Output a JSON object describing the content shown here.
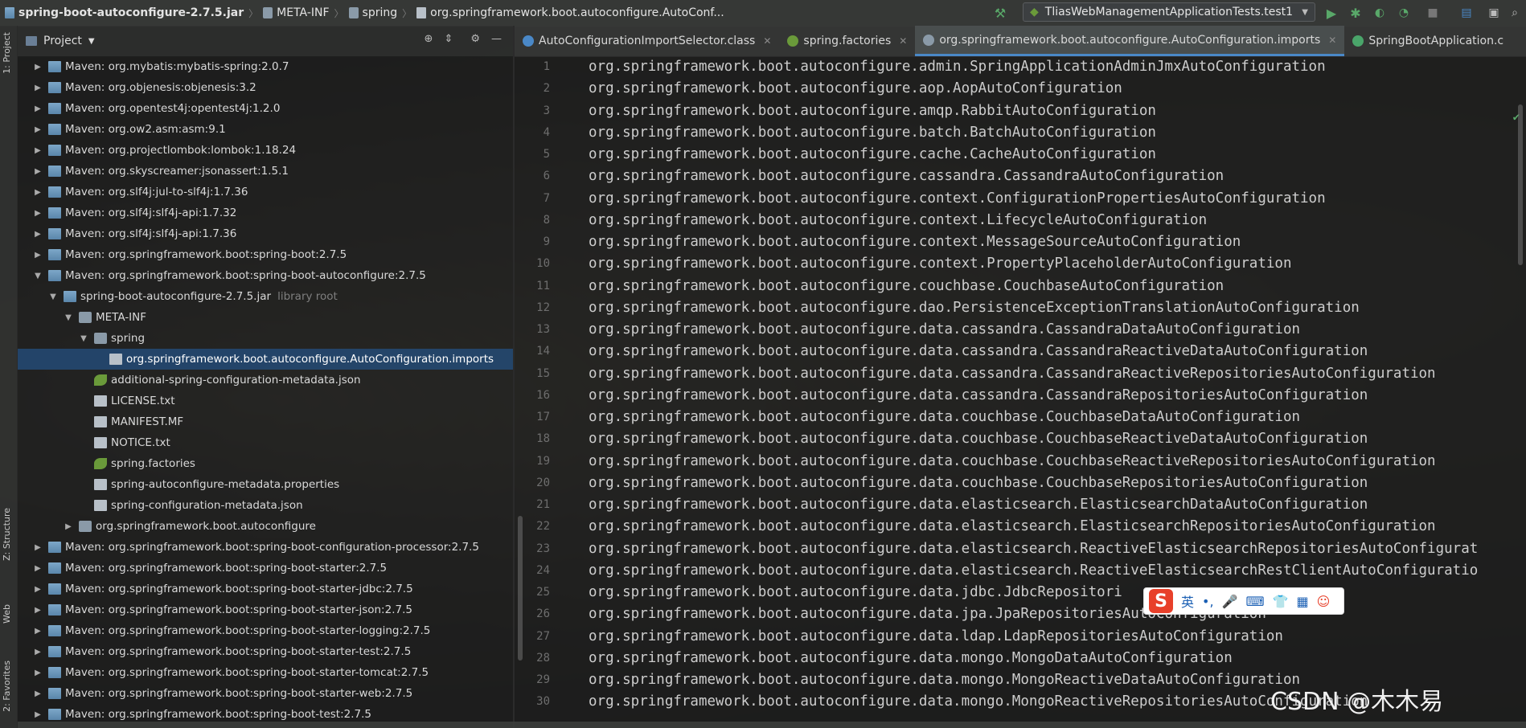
{
  "breadcrumbs": [
    {
      "label": "spring-boot-autoconfigure-2.7.5.jar",
      "bold": true
    },
    {
      "label": "META-INF"
    },
    {
      "label": "spring"
    },
    {
      "label": "org.springframework.boot.autoconfigure.AutoConf..."
    }
  ],
  "run_config": "TliasWebManagementApplicationTests.test1",
  "left_strip": {
    "project": "1: Project",
    "structure": "Z: Structure",
    "web": "Web",
    "favorites": "2: Favorites"
  },
  "project_panel": {
    "title": "Project",
    "tree": [
      {
        "label": "Maven: org.mybatis:mybatis-spring:2.0.7",
        "indent": 0,
        "twisty": "▶",
        "icon": "lib"
      },
      {
        "label": "Maven: org.objenesis:objenesis:3.2",
        "indent": 0,
        "twisty": "▶",
        "icon": "lib"
      },
      {
        "label": "Maven: org.opentest4j:opentest4j:1.2.0",
        "indent": 0,
        "twisty": "▶",
        "icon": "lib"
      },
      {
        "label": "Maven: org.ow2.asm:asm:9.1",
        "indent": 0,
        "twisty": "▶",
        "icon": "lib"
      },
      {
        "label": "Maven: org.projectlombok:lombok:1.18.24",
        "indent": 0,
        "twisty": "▶",
        "icon": "lib"
      },
      {
        "label": "Maven: org.skyscreamer:jsonassert:1.5.1",
        "indent": 0,
        "twisty": "▶",
        "icon": "lib"
      },
      {
        "label": "Maven: org.slf4j:jul-to-slf4j:1.7.36",
        "indent": 0,
        "twisty": "▶",
        "icon": "lib"
      },
      {
        "label": "Maven: org.slf4j:slf4j-api:1.7.32",
        "indent": 0,
        "twisty": "▶",
        "icon": "lib"
      },
      {
        "label": "Maven: org.slf4j:slf4j-api:1.7.36",
        "indent": 0,
        "twisty": "▶",
        "icon": "lib"
      },
      {
        "label": "Maven: org.springframework.boot:spring-boot:2.7.5",
        "indent": 0,
        "twisty": "▶",
        "icon": "lib"
      },
      {
        "label": "Maven: org.springframework.boot:spring-boot-autoconfigure:2.7.5",
        "indent": 0,
        "twisty": "▼",
        "icon": "lib"
      },
      {
        "label": "spring-boot-autoconfigure-2.7.5.jar",
        "note": "library root",
        "indent": 1,
        "twisty": "▼",
        "icon": "lib"
      },
      {
        "label": "META-INF",
        "indent": 2,
        "twisty": "▼",
        "icon": "folder"
      },
      {
        "label": "spring",
        "indent": 3,
        "twisty": "▼",
        "icon": "folder"
      },
      {
        "label": "org.springframework.boot.autoconfigure.AutoConfiguration.imports",
        "indent": 4,
        "twisty": "",
        "icon": "file",
        "selected": true
      },
      {
        "label": "additional-spring-configuration-metadata.json",
        "indent": 3,
        "twisty": "",
        "icon": "leaf"
      },
      {
        "label": "LICENSE.txt",
        "indent": 3,
        "twisty": "",
        "icon": "file"
      },
      {
        "label": "MANIFEST.MF",
        "indent": 3,
        "twisty": "",
        "icon": "file"
      },
      {
        "label": "NOTICE.txt",
        "indent": 3,
        "twisty": "",
        "icon": "file"
      },
      {
        "label": "spring.factories",
        "indent": 3,
        "twisty": "",
        "icon": "leaf"
      },
      {
        "label": "spring-autoconfigure-metadata.properties",
        "indent": 3,
        "twisty": "",
        "icon": "file"
      },
      {
        "label": "spring-configuration-metadata.json",
        "indent": 3,
        "twisty": "",
        "icon": "file"
      },
      {
        "label": "org.springframework.boot.autoconfigure",
        "indent": 2,
        "twisty": "▶",
        "icon": "folder"
      },
      {
        "label": "Maven: org.springframework.boot:spring-boot-configuration-processor:2.7.5",
        "indent": 0,
        "twisty": "▶",
        "icon": "lib"
      },
      {
        "label": "Maven: org.springframework.boot:spring-boot-starter:2.7.5",
        "indent": 0,
        "twisty": "▶",
        "icon": "lib"
      },
      {
        "label": "Maven: org.springframework.boot:spring-boot-starter-jdbc:2.7.5",
        "indent": 0,
        "twisty": "▶",
        "icon": "lib"
      },
      {
        "label": "Maven: org.springframework.boot:spring-boot-starter-json:2.7.5",
        "indent": 0,
        "twisty": "▶",
        "icon": "lib"
      },
      {
        "label": "Maven: org.springframework.boot:spring-boot-starter-logging:2.7.5",
        "indent": 0,
        "twisty": "▶",
        "icon": "lib"
      },
      {
        "label": "Maven: org.springframework.boot:spring-boot-starter-test:2.7.5",
        "indent": 0,
        "twisty": "▶",
        "icon": "lib"
      },
      {
        "label": "Maven: org.springframework.boot:spring-boot-starter-tomcat:2.7.5",
        "indent": 0,
        "twisty": "▶",
        "icon": "lib"
      },
      {
        "label": "Maven: org.springframework.boot:spring-boot-starter-web:2.7.5",
        "indent": 0,
        "twisty": "▶",
        "icon": "lib"
      },
      {
        "label": "Maven: org.springframework.boot:spring-boot-test:2.7.5",
        "indent": 0,
        "twisty": "▶",
        "icon": "lib"
      }
    ]
  },
  "tabs": [
    {
      "label": "AutoConfigurationImportSelector.class",
      "color": "#4a88c7"
    },
    {
      "label": "spring.factories",
      "color": "#6a9a3a"
    },
    {
      "label": "org.springframework.boot.autoconfigure.AutoConfiguration.imports",
      "color": "#8a9aa8",
      "active": true
    },
    {
      "label": "SpringBootApplication.c",
      "color": "#4aa56a"
    }
  ],
  "editor_lines": [
    "org.springframework.boot.autoconfigure.admin.SpringApplicationAdminJmxAutoConfiguration",
    "org.springframework.boot.autoconfigure.aop.AopAutoConfiguration",
    "org.springframework.boot.autoconfigure.amqp.RabbitAutoConfiguration",
    "org.springframework.boot.autoconfigure.batch.BatchAutoConfiguration",
    "org.springframework.boot.autoconfigure.cache.CacheAutoConfiguration",
    "org.springframework.boot.autoconfigure.cassandra.CassandraAutoConfiguration",
    "org.springframework.boot.autoconfigure.context.ConfigurationPropertiesAutoConfiguration",
    "org.springframework.boot.autoconfigure.context.LifecycleAutoConfiguration",
    "org.springframework.boot.autoconfigure.context.MessageSourceAutoConfiguration",
    "org.springframework.boot.autoconfigure.context.PropertyPlaceholderAutoConfiguration",
    "org.springframework.boot.autoconfigure.couchbase.CouchbaseAutoConfiguration",
    "org.springframework.boot.autoconfigure.dao.PersistenceExceptionTranslationAutoConfiguration",
    "org.springframework.boot.autoconfigure.data.cassandra.CassandraDataAutoConfiguration",
    "org.springframework.boot.autoconfigure.data.cassandra.CassandraReactiveDataAutoConfiguration",
    "org.springframework.boot.autoconfigure.data.cassandra.CassandraReactiveRepositoriesAutoConfiguration",
    "org.springframework.boot.autoconfigure.data.cassandra.CassandraRepositoriesAutoConfiguration",
    "org.springframework.boot.autoconfigure.data.couchbase.CouchbaseDataAutoConfiguration",
    "org.springframework.boot.autoconfigure.data.couchbase.CouchbaseReactiveDataAutoConfiguration",
    "org.springframework.boot.autoconfigure.data.couchbase.CouchbaseReactiveRepositoriesAutoConfiguration",
    "org.springframework.boot.autoconfigure.data.couchbase.CouchbaseRepositoriesAutoConfiguration",
    "org.springframework.boot.autoconfigure.data.elasticsearch.ElasticsearchDataAutoConfiguration",
    "org.springframework.boot.autoconfigure.data.elasticsearch.ElasticsearchRepositoriesAutoConfiguration",
    "org.springframework.boot.autoconfigure.data.elasticsearch.ReactiveElasticsearchRepositoriesAutoConfigurat",
    "org.springframework.boot.autoconfigure.data.elasticsearch.ReactiveElasticsearchRestClientAutoConfiguratio",
    "org.springframework.boot.autoconfigure.data.jdbc.JdbcRepositori",
    "org.springframework.boot.autoconfigure.data.jpa.JpaRepositoriesAutoConfiguration",
    "org.springframework.boot.autoconfigure.data.ldap.LdapRepositoriesAutoConfiguration",
    "org.springframework.boot.autoconfigure.data.mongo.MongoDataAutoConfiguration",
    "org.springframework.boot.autoconfigure.data.mongo.MongoReactiveDataAutoConfiguration",
    "org.springframework.boot.autoconfigure.data.mongo.MongoReactiveRepositoriesAutoConfiguration"
  ],
  "ime": {
    "lang": "英",
    "punct": "•,"
  },
  "watermark": "CSDN @木木易"
}
